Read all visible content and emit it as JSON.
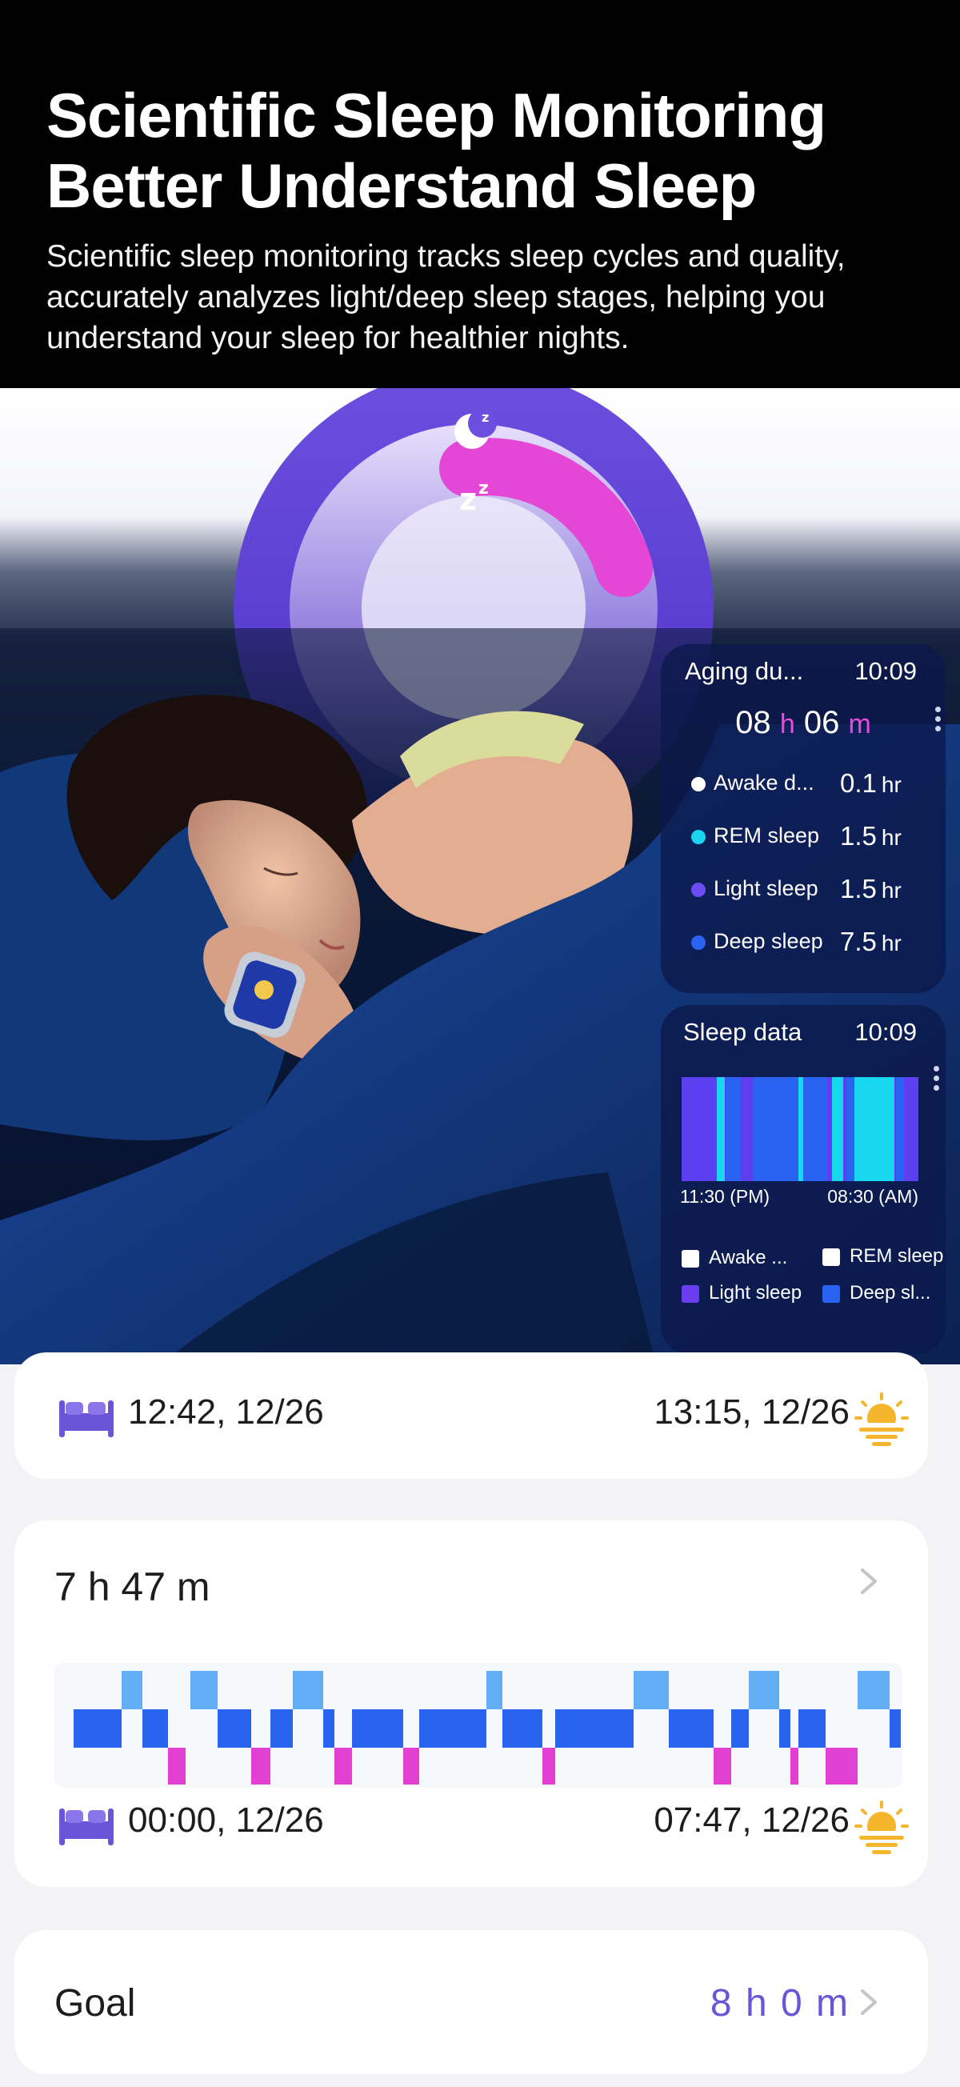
{
  "header": {
    "title_line1": "Scientific Sleep Monitoring",
    "title_line2": "Better Understand Sleep",
    "subtitle_line1": "Scientific sleep monitoring tracks sleep cycles and quality,",
    "subtitle_line2": "accurately analyzes light/deep sleep stages, helping you",
    "subtitle_line3": "understand your sleep for healthier nights."
  },
  "duration_card": {
    "label": "Aging du...",
    "time": "10:09",
    "hours": "08",
    "hours_unit": "h",
    "minutes": "06",
    "minutes_unit": "m",
    "stats": [
      {
        "label": "Awake d...",
        "value": "0.1",
        "unit": "hr",
        "color": "#ffffff"
      },
      {
        "label": "REM sleep",
        "value": "1.5",
        "unit": "hr",
        "color": "#19d4ee"
      },
      {
        "label": "Light sleep",
        "value": "1.5",
        "unit": "hr",
        "color": "#6a4cf0"
      },
      {
        "label": "Deep sleep",
        "value": "7.5",
        "unit": "hr",
        "color": "#2a63f2"
      }
    ]
  },
  "data_card": {
    "label": "Sleep data",
    "time": "10:09",
    "start_label": "11:30 (PM)",
    "end_label": "08:30 (AM)",
    "legend": [
      {
        "label": "Awake ...",
        "color": "#ffffff"
      },
      {
        "label": "REM sleep",
        "color": "#ffffff"
      },
      {
        "label": "Light sleep",
        "color": "#6a3df0"
      },
      {
        "label": "Deep sl...",
        "color": "#2a63f2"
      }
    ]
  },
  "record_card": {
    "bed_time": "12:42, 12/26",
    "wake_time": "13:15, 12/26"
  },
  "summary_card": {
    "duration": "7 h 47 m",
    "bed_time": "00:00, 12/26",
    "wake_time": "07:47, 12/26"
  },
  "goal_card": {
    "label": "Goal",
    "value": "8 h 0 m"
  },
  "colors": {
    "accent": "#6a54d8",
    "deep": "#2a63ee",
    "light": "#62aef4",
    "rem": "#e23fd3",
    "sun": "#f5b52c"
  }
}
